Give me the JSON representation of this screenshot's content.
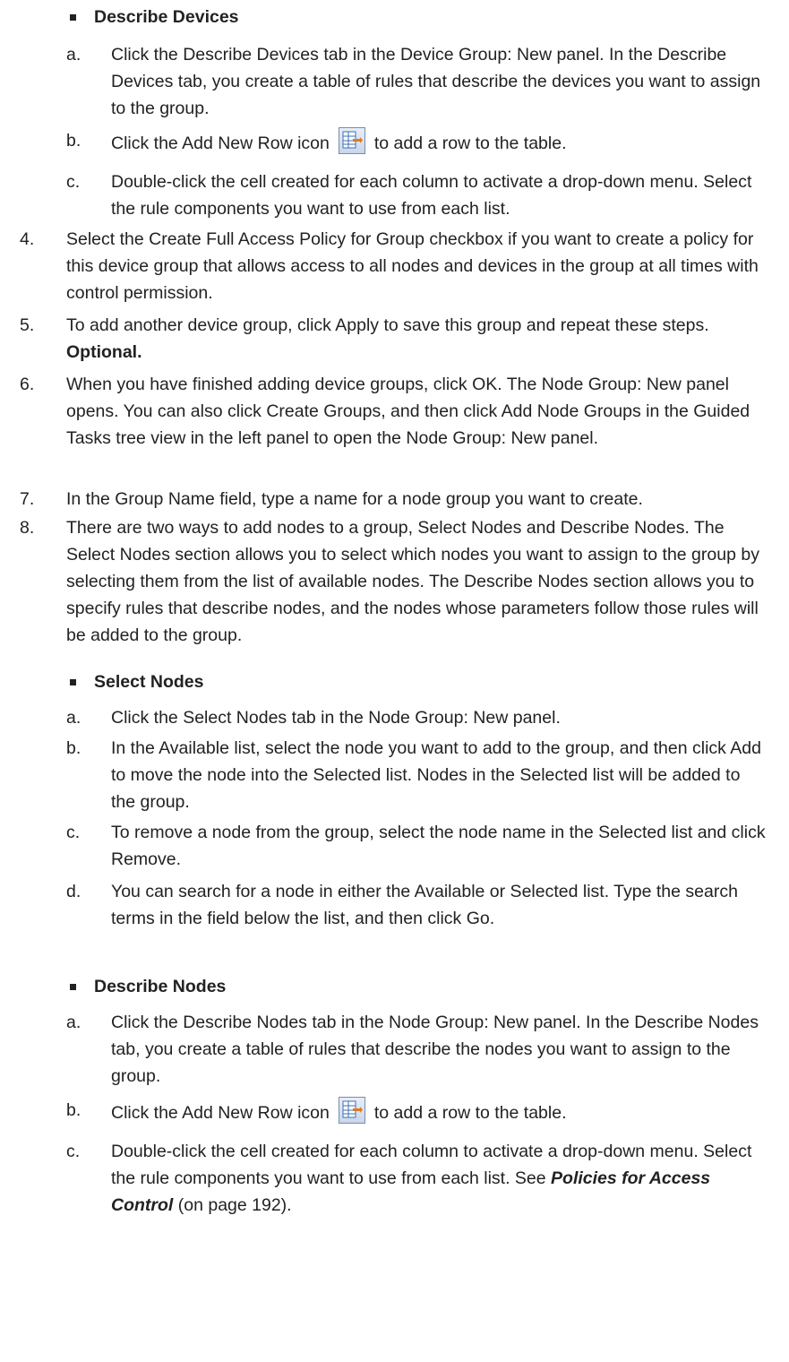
{
  "sections": {
    "describe_devices": {
      "heading": "Describe Devices",
      "a": "Click the Describe Devices tab in the Device Group: New panel. In the Describe Devices tab, you create a table of rules that describe the devices you want to assign to the group.",
      "b_pre": "Click the Add New Row icon",
      "b_post": "to add a row to the table.",
      "c": "Double-click the cell created for each column to activate a drop-down menu. Select the rule components you want to use from each list."
    },
    "steps": {
      "s4": "Select the Create Full Access Policy for Group checkbox if you want to create a policy for this device group that allows access to all nodes and devices in the group at all times with control permission.",
      "s5_pre": "To add another device group, click Apply to save this group and repeat these steps.",
      "s5_bold": "Optional.",
      "s6": "When you have finished adding device groups, click OK. The Node Group: New panel opens. You can also click Create Groups, and then click Add Node Groups in the Guided Tasks tree view in the left panel to open the Node Group: New panel.",
      "s7": "In the Group Name field, type a name for a node group you want to create.",
      "s8": "There are two ways to add nodes to a group, Select Nodes and Describe Nodes. The Select Nodes section allows you to select which nodes you want to assign to the group by selecting them from the list of available nodes. The Describe Nodes section allows you to specify rules that describe nodes, and the nodes whose parameters follow those rules will be added to the group."
    },
    "select_nodes": {
      "heading": "Select Nodes",
      "a": "Click the Select Nodes tab in the Node Group: New panel.",
      "b": "In the Available list, select the node you want to add to the group, and then click Add to move the node into the Selected list. Nodes in the Selected list will be added to the group.",
      "c": "To remove a node from the group, select the node name in the Selected list and click Remove.",
      "d": "You can search for a node in either the Available or Selected list. Type the search terms in the field below the list, and then click Go."
    },
    "describe_nodes": {
      "heading": "Describe Nodes",
      "a": "Click the Describe Nodes tab in the Node Group: New panel. In the Describe Nodes tab, you create a table of rules that describe the nodes you want to assign to the group.",
      "b_pre": "Click the Add New Row icon",
      "b_post": "to add a row to the table.",
      "c_pre": "Double-click the cell created for each column to activate a drop-down menu. Select the rule components you want to use from each list. See",
      "c_link": "Policies for Access Control",
      "c_post": "(on page 192)."
    }
  },
  "markers": {
    "a": "a.",
    "b": "b.",
    "c": "c.",
    "d": "d.",
    "n4": "4.",
    "n5": "5.",
    "n6": "6.",
    "n7": "7.",
    "n8": "8."
  },
  "icon": "add-new-row-icon"
}
